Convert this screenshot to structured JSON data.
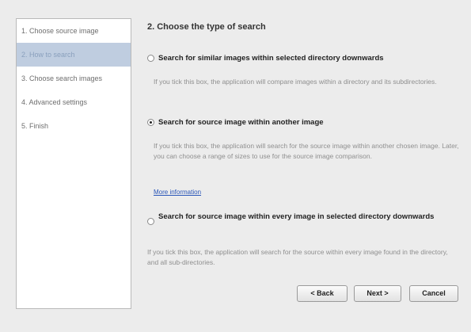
{
  "sidebar": {
    "items": [
      {
        "label": "1. Choose source image"
      },
      {
        "label": "2. How to search"
      },
      {
        "label": "3. Choose search images"
      },
      {
        "label": "4. Advanced settings"
      },
      {
        "label": "5. Finish"
      }
    ],
    "active_index": 1
  },
  "main": {
    "title": "2. Choose the type of search",
    "options": [
      {
        "label": "Search for similar images within selected directory downwards",
        "checked": false,
        "description": "If you tick this box, the application will compare images within a directory and its subdirectories."
      },
      {
        "label": "Search for source image within another image",
        "checked": true,
        "description": "If you tick this box, the application will search for the source image within another chosen image. Later, you can choose a range of sizes to use for the source image comparison.",
        "link": "More information"
      },
      {
        "label": "Search for source image within every image in selected directory downwards",
        "checked": false,
        "description": "If you tick this box, the application will search for the source within every image found in the directory, and all sub-directories."
      }
    ]
  },
  "footer": {
    "back_label": "< Back",
    "next_label": "Next >",
    "cancel_label": "Cancel"
  },
  "colors": {
    "sidebar_active": "#bfcde0",
    "link": "#2a56b8",
    "description_text": "#8f8f8f"
  }
}
